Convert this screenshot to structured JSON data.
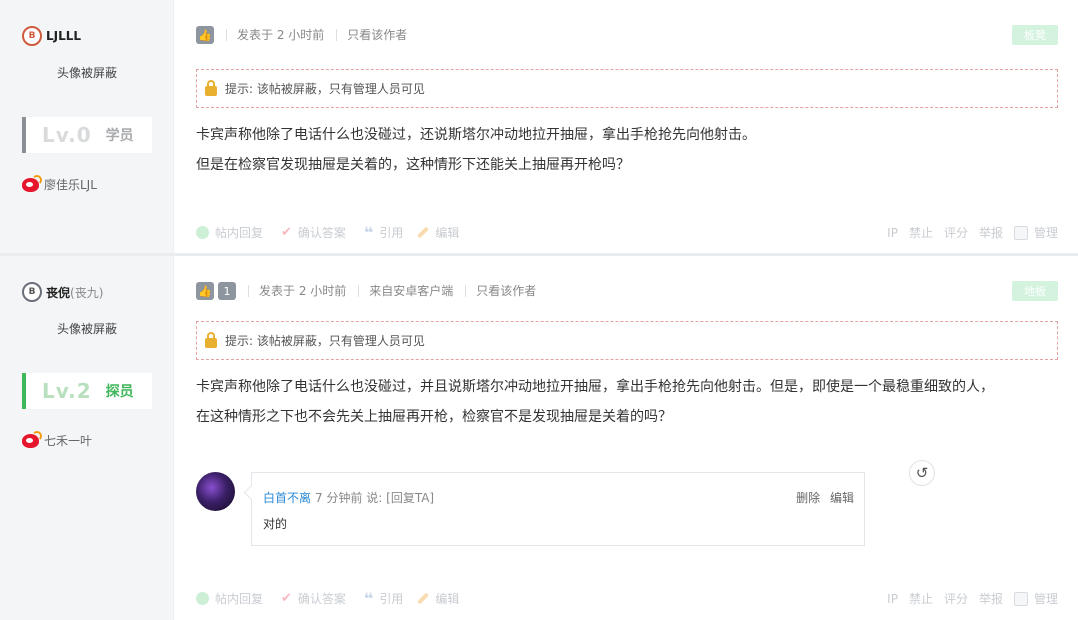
{
  "posts": [
    {
      "author": {
        "name": "LJLLL",
        "sub": "",
        "badge_glyph": "B"
      },
      "avatar_text": "头像被屏蔽",
      "level": {
        "lv": "Lv.0",
        "rank": "学员"
      },
      "weibo_name": "廖佳乐LJL",
      "meta": {
        "like_count": "",
        "posted": "发表于 2 小时前",
        "client": "",
        "only_author": "只看该作者"
      },
      "floor": "板凳",
      "notice": "提示: 该帖被屏蔽，只有管理人员可见",
      "body": [
        "卡宾声称他除了电话什么也没碰过，还说斯塔尔冲动地拉开抽屉，拿出手枪抢先向他射击。",
        "但是在检察官发现抽屉是关着的，这种情形下还能关上抽屉再开枪吗？"
      ],
      "actions": {
        "reply": "帖内回复",
        "accept": "确认答案",
        "quote": "引用",
        "edit": "编辑",
        "ip": "IP",
        "ban": "禁止",
        "rate": "评分",
        "report": "举报",
        "manage": "管理"
      }
    },
    {
      "author": {
        "name": "丧倪",
        "sub": "(丧九)",
        "badge_glyph": "B"
      },
      "avatar_text": "头像被屏蔽",
      "level": {
        "lv": "Lv.2",
        "rank": "探员"
      },
      "weibo_name": "七禾一叶",
      "meta": {
        "like_count": "1",
        "posted": "发表于 2 小时前",
        "client": "来自安卓客户端",
        "only_author": "只看该作者"
      },
      "floor": "地板",
      "notice": "提示: 该帖被屏蔽，只有管理人员可见",
      "body": [
        "卡宾声称他除了电话什么也没碰过，并且说斯塔尔冲动地拉开抽屉，拿出手枪抢先向他射击。但是，即使是一个最稳重细致的人，",
        "在这种情形之下也不会先关上抽屉再开枪，检察官不是发现抽屉是关着的吗？"
      ],
      "reply": {
        "user": "白首不离",
        "time": "7 分钟前 说: [回复TA]",
        "delete": "删除",
        "edit": "编辑",
        "text": "对的"
      },
      "actions": {
        "reply": "帖内回复",
        "accept": "确认答案",
        "quote": "引用",
        "edit": "编辑",
        "ip": "IP",
        "ban": "禁止",
        "rate": "评分",
        "report": "举报",
        "manage": "管理"
      }
    }
  ],
  "colors": {
    "accent_green": "#3fb65a",
    "link_blue": "#2b8ad6",
    "notice_border": "#e4a2a2",
    "weibo_red": "#e6162d"
  },
  "icons": {
    "like": "thumbs-up-icon",
    "lock": "lock-icon",
    "weibo": "weibo-icon",
    "refresh": "refresh-icon"
  }
}
